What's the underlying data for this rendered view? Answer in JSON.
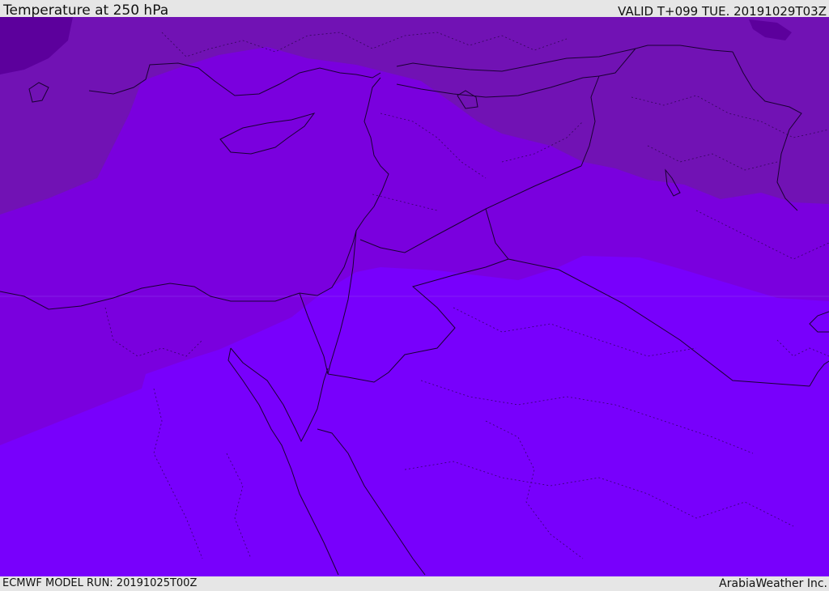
{
  "header": {
    "title": "Temperature at 250 hPa",
    "valid_time": "VALID T+099 TUE. 20191029T03Z"
  },
  "footer": {
    "model_run": "ECMWF MODEL RUN: 20191025T00Z",
    "credit": "ArabiaWeather Inc."
  },
  "colors": {
    "band_coldest": "#5c009c",
    "band_cold": "#7112b4",
    "band_mid": "#7a00de",
    "band_warm": "#7800fc",
    "boundary_line": "#1a0033"
  }
}
